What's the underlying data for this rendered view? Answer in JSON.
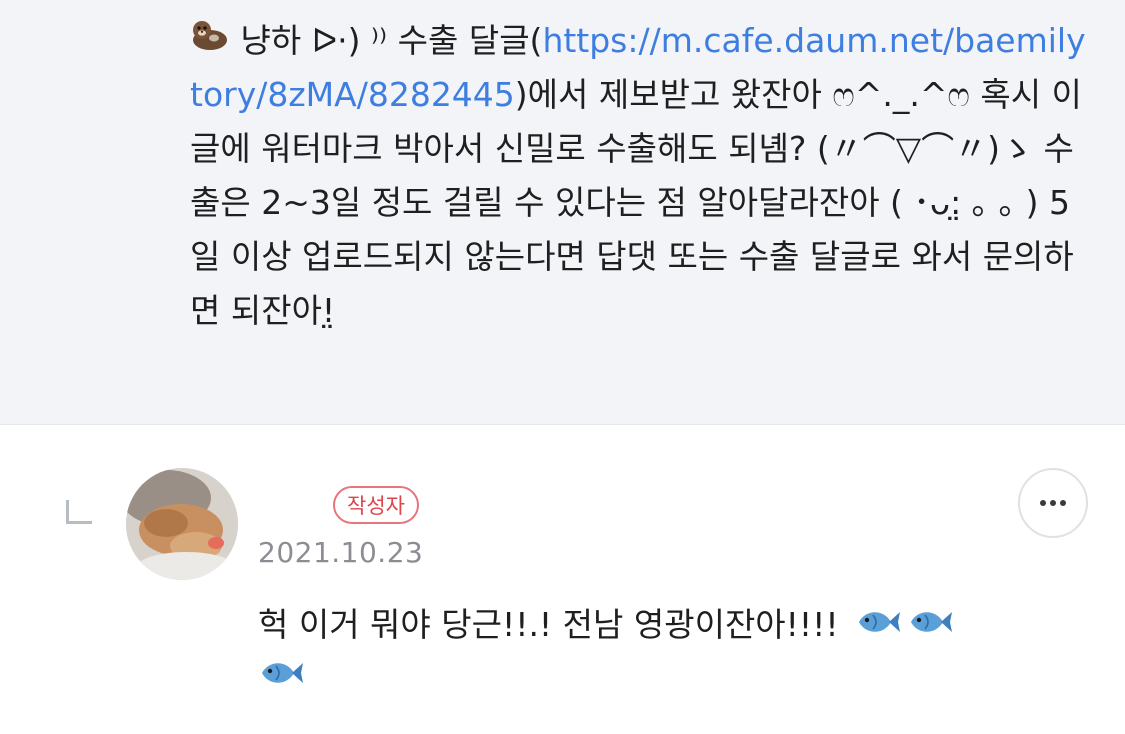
{
  "parent_comment": {
    "icon": "otter-icon",
    "text_before_link": " 냥하 ᐅ·) ⁾⁾ 수출 달글(",
    "link": "https://m.cafe.daum.net/baemilytory/8zMA/8282445",
    "text_after_link": ")에서 제보받고 왔잔아 ෆ^._.^ෆ 혹시 이 글에 워터마크 박아서 신밀로 수출해도 되녬? (〃⌒▽⌒〃)ゝ 수출은 2~3일 정도 걸릴 수 있다는 점 알아달라잔아 ( ･ᴗ:̤ ｡ ｡ ) 5일 이상 업로드되지 않는다면 답댓 또는 수출 달글로 와서 문의하면 되잔아!̤"
  },
  "reply": {
    "author_badge": "작성자",
    "date": "2021.10.23",
    "text": "헉 이거 뭐야 당근!!.! 전남 영광이잔아!!!!",
    "fish_icons": [
      "fish-icon",
      "fish-icon",
      "fish-icon"
    ]
  },
  "colors": {
    "background_top": "#f2f4f8",
    "link": "#3d7ee0",
    "badge": "#e0454c",
    "date": "#8a8d93"
  }
}
